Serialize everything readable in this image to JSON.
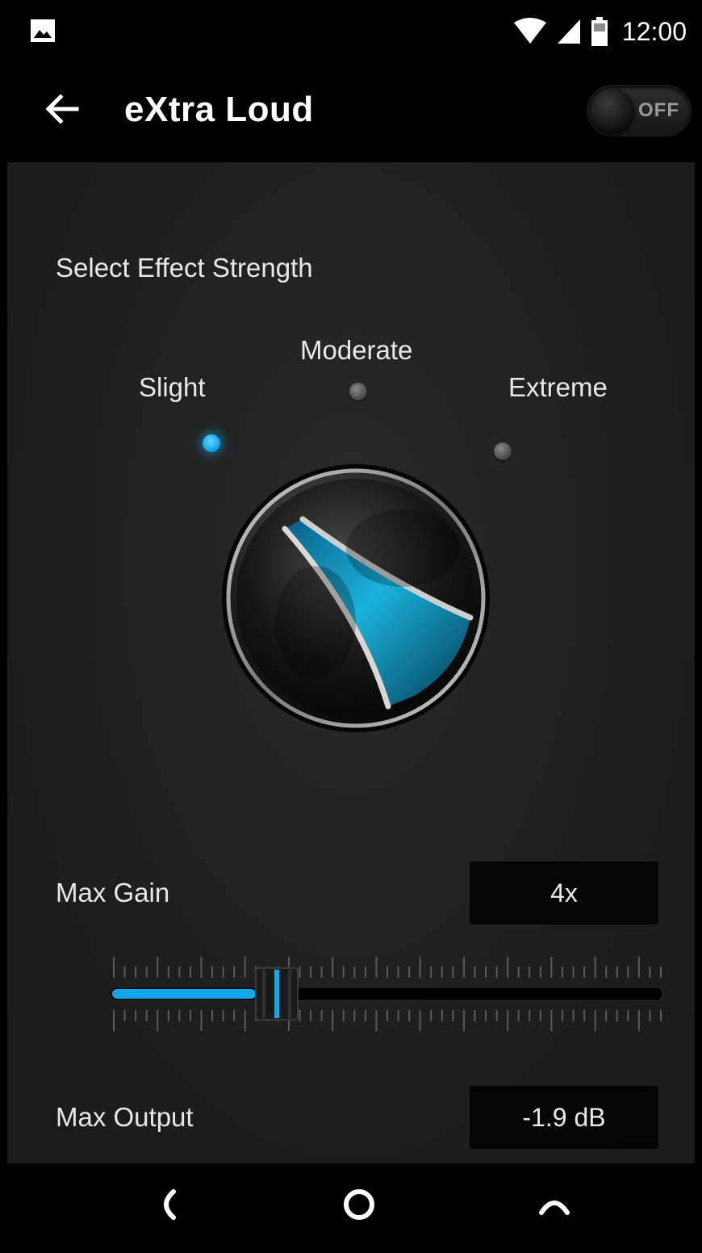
{
  "status_bar": {
    "time": "12:00",
    "icons": [
      "gallery-icon",
      "wifi-icon",
      "signal-icon",
      "battery-icon"
    ]
  },
  "app_bar": {
    "title": "eXtra Loud",
    "toggle_label": "OFF",
    "toggle_on": false
  },
  "effect_strength": {
    "label": "Select Effect Strength",
    "options": [
      "Slight",
      "Moderate",
      "Extreme"
    ],
    "selected": "Slight"
  },
  "max_gain": {
    "label": "Max Gain",
    "value": "4x",
    "slider_fraction": 0.3
  },
  "max_output": {
    "label": "Max Output",
    "value": "-1.9 dB"
  },
  "colors": {
    "accent": "#14a6ea",
    "background": "#1f1f1f",
    "bar": "#000000"
  },
  "nav_bar": {
    "icons": [
      "back-nav-icon",
      "home-nav-icon",
      "recents-nav-icon"
    ]
  }
}
